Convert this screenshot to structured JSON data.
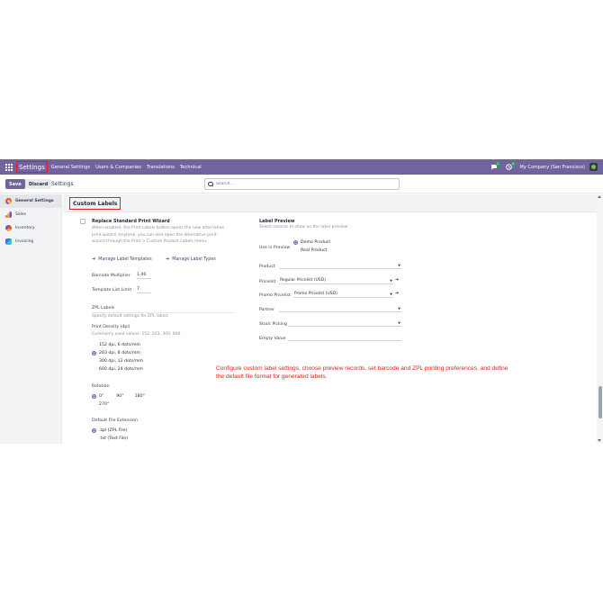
{
  "navbar": {
    "app_name": "Settings",
    "menu": [
      "General Settings",
      "Users & Companies",
      "Translations",
      "Technical"
    ],
    "messages_badge": "1",
    "activities_badge": "4",
    "company": "My Company (San Francisco)"
  },
  "control_panel": {
    "save_label": "Save",
    "discard_label": "Discard",
    "title": "Settings",
    "search_placeholder": "Search..."
  },
  "sidebar": {
    "items": [
      {
        "label": "General Settings",
        "icon": "settings-icon",
        "active": true
      },
      {
        "label": "Sales",
        "icon": "sales-icon",
        "active": false
      },
      {
        "label": "Inventory",
        "icon": "inventory-icon",
        "active": false
      },
      {
        "label": "Invoicing",
        "icon": "invoicing-icon",
        "active": false
      }
    ]
  },
  "section": {
    "title": "Custom Labels"
  },
  "left": {
    "replace_wizard": {
      "title": "Replace Standard Print Wizard",
      "desc_1": "When enabled, the Print Labels button opens the new alternative",
      "desc_2": "print wizard. Anytime, you can also open the alternative print",
      "desc_3": "wizard through the Print > Custom Product Labels menu."
    },
    "manage_templates": "Manage Label Templates",
    "manage_types": "Manage Label Types",
    "barcode_multiplier_label": "Barcode Multiplier",
    "barcode_multiplier_value": "1.00",
    "template_list_limit_label": "Template List Limit",
    "template_list_limit_value": "7",
    "zpl_title": "ZPL Labels",
    "zpl_desc": "Specify default settings for ZPL labels",
    "print_density_label": "Print Density (dpi)",
    "print_density_hint": "Commonly used values: 152, 203, 300, 600.",
    "density_options": [
      {
        "label": "152 dpi, 6 dots/mm",
        "selected": false
      },
      {
        "label": "203 dpi, 8 dots/mm",
        "selected": true
      },
      {
        "label": "300 dpi, 12 dots/mm",
        "selected": false
      },
      {
        "label": "600 dpi, 24 dots/mm",
        "selected": false
      }
    ],
    "rotation_label": "Rotation",
    "rotation_options": [
      {
        "label": "0°",
        "selected": true
      },
      {
        "label": "90°",
        "selected": false
      },
      {
        "label": "180°",
        "selected": false
      },
      {
        "label": "270°",
        "selected": false
      }
    ],
    "file_ext_label": "Default File Extension",
    "file_ext_options": [
      {
        "label": ".zpl (ZPL File)",
        "selected": true
      },
      {
        "label": ".txt (Text File)",
        "selected": false
      }
    ]
  },
  "right": {
    "title": "Label Preview",
    "desc": "Select records to show on the label preview",
    "use_in_preview_label": "Use in Preview",
    "use_options": [
      {
        "label": "Demo Product",
        "selected": true
      },
      {
        "label": "Real Product",
        "selected": false
      }
    ],
    "product_label": "Product",
    "product_value": "",
    "pricelist_label": "Pricelist",
    "pricelist_value": "Regular Pricelist (USD)",
    "promo_pricelist_label": "Promo Pricelist",
    "promo_pricelist_value": "Promo Pricelist (USD)",
    "partner_label": "Partner",
    "partner_value": "",
    "stock_picking_label": "Stock Picking",
    "stock_picking_value": "",
    "empty_value_label": "Empty Value",
    "empty_value_value": ""
  },
  "annotation": "Configure custom label settings, choose preview records, set barcode and ZPL printing preferences, and define the default file format for generated labels.",
  "colors": {
    "navbar": "#71639e",
    "primary": "#71639e",
    "highlight_box": "#e02020",
    "annotation": "#e0201b"
  }
}
